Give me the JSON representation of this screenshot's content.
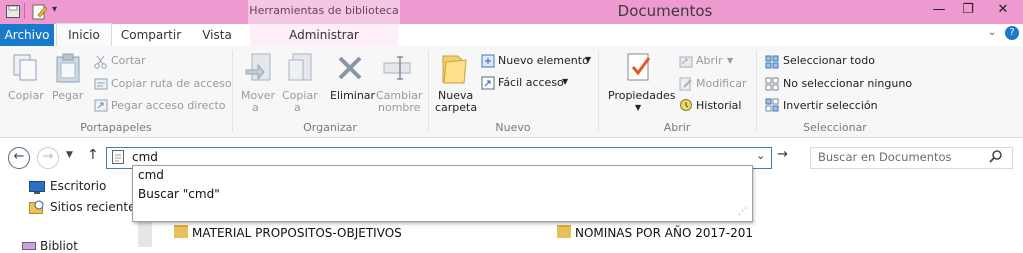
{
  "window": {
    "title": "Documentos",
    "contextual_tab_group": "Herramientas de biblioteca",
    "controls": {
      "minimize": "—",
      "maximize": "❐",
      "close": "✕"
    },
    "title_bar_color": "#ee9ad0"
  },
  "quick_access": {
    "save_icon": "save-icon",
    "new_folder_icon": "edit-icon",
    "dropdown": "▾"
  },
  "tabs": {
    "archivo": "Archivo",
    "inicio": "Inicio",
    "compartir": "Compartir",
    "vista": "Vista",
    "administrar": "Administrar"
  },
  "ribbon": {
    "portapapeles": {
      "label": "Portapapeles",
      "copiar": "Copiar",
      "pegar": "Pegar",
      "cortar": "Cortar",
      "copiar_ruta": "Copiar ruta de acceso",
      "pegar_acceso": "Pegar acceso directo"
    },
    "organizar": {
      "label": "Organizar",
      "mover_a_1": "Mover",
      "mover_a_2": "a",
      "copiar_a_1": "Copiar",
      "copiar_a_2": "a",
      "eliminar": "Eliminar",
      "cambiar_1": "Cambiar",
      "cambiar_2": "nombre"
    },
    "nuevo": {
      "label": "Nuevo",
      "nueva_1": "Nueva",
      "nueva_2": "carpeta",
      "nuevo_elemento": "Nuevo elemento",
      "facil_acceso": "Fácil acceso"
    },
    "abrir": {
      "label": "Abrir",
      "propiedades": "Propiedades",
      "abrir": "Abrir",
      "modificar": "Modificar",
      "historial": "Historial"
    },
    "seleccionar": {
      "label": "Seleccionar",
      "todo": "Seleccionar todo",
      "ninguno": "No seleccionar ninguno",
      "invertir": "Invertir selección"
    }
  },
  "address": {
    "value": "cmd",
    "search_placeholder": "Buscar en Documentos"
  },
  "autocomplete": {
    "items": [
      "cmd",
      "Buscar \"cmd\""
    ]
  },
  "navpane": {
    "items": [
      "Escritorio",
      "Sitios recientes",
      "Bibliot"
    ]
  },
  "content": {
    "folders": [
      "MATERIAL PROPOSITOS-OBJETIVOS",
      "NOMINAS POR AÑO 2017-201"
    ]
  },
  "colors": {
    "accent": "#1979ca",
    "contextual": "#f4c7e3"
  }
}
